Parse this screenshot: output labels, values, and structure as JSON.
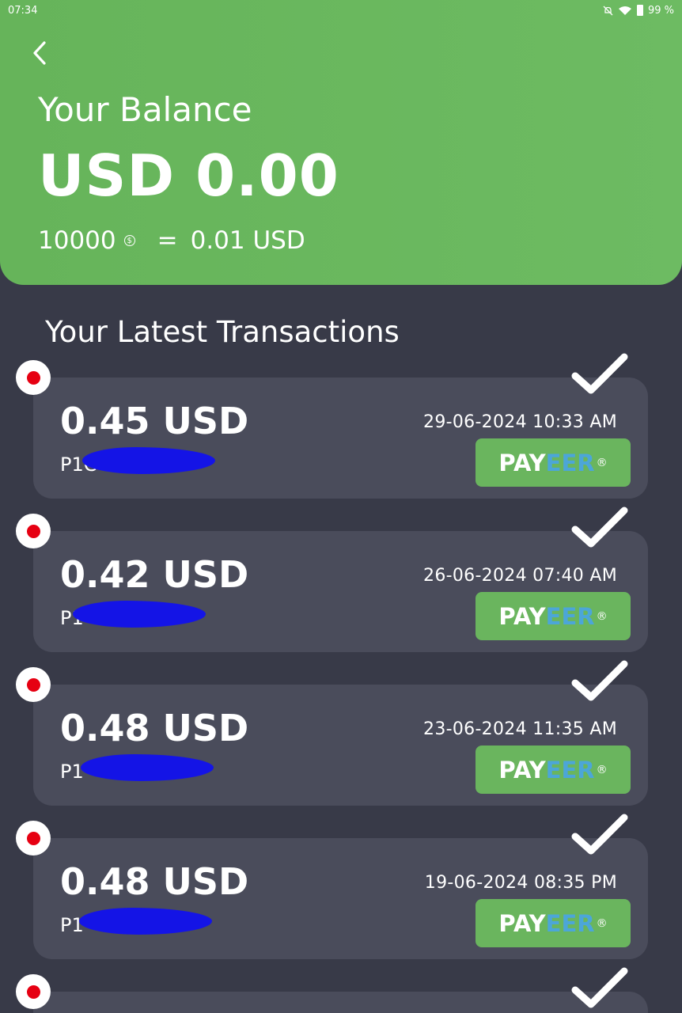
{
  "status_bar": {
    "time": "07:34",
    "battery": "99 %"
  },
  "header": {
    "balance_label": "Your Balance",
    "balance_amount": "USD 0.00",
    "rate_coins": "10000",
    "rate_equals": "=",
    "rate_value": "0.01 USD"
  },
  "transactions_title": "Your Latest Transactions",
  "transactions": [
    {
      "amount": "0.45 USD",
      "account": "P1C",
      "date": "29-06-2024 10:33 AM",
      "method_a": "PAY",
      "method_b": "EER",
      "method_mark": "®"
    },
    {
      "amount": "0.42 USD",
      "account": "P1",
      "date": "26-06-2024 07:40 AM",
      "method_a": "PAY",
      "method_b": "EER",
      "method_mark": "®"
    },
    {
      "amount": "0.48 USD",
      "account": "P1",
      "date": "23-06-2024 11:35 AM",
      "method_a": "PAY",
      "method_b": "EER",
      "method_mark": "®"
    },
    {
      "amount": "0.48 USD",
      "account": "P1",
      "date": "19-06-2024 08:35 PM",
      "method_a": "PAY",
      "method_b": "EER",
      "method_mark": "®"
    }
  ]
}
